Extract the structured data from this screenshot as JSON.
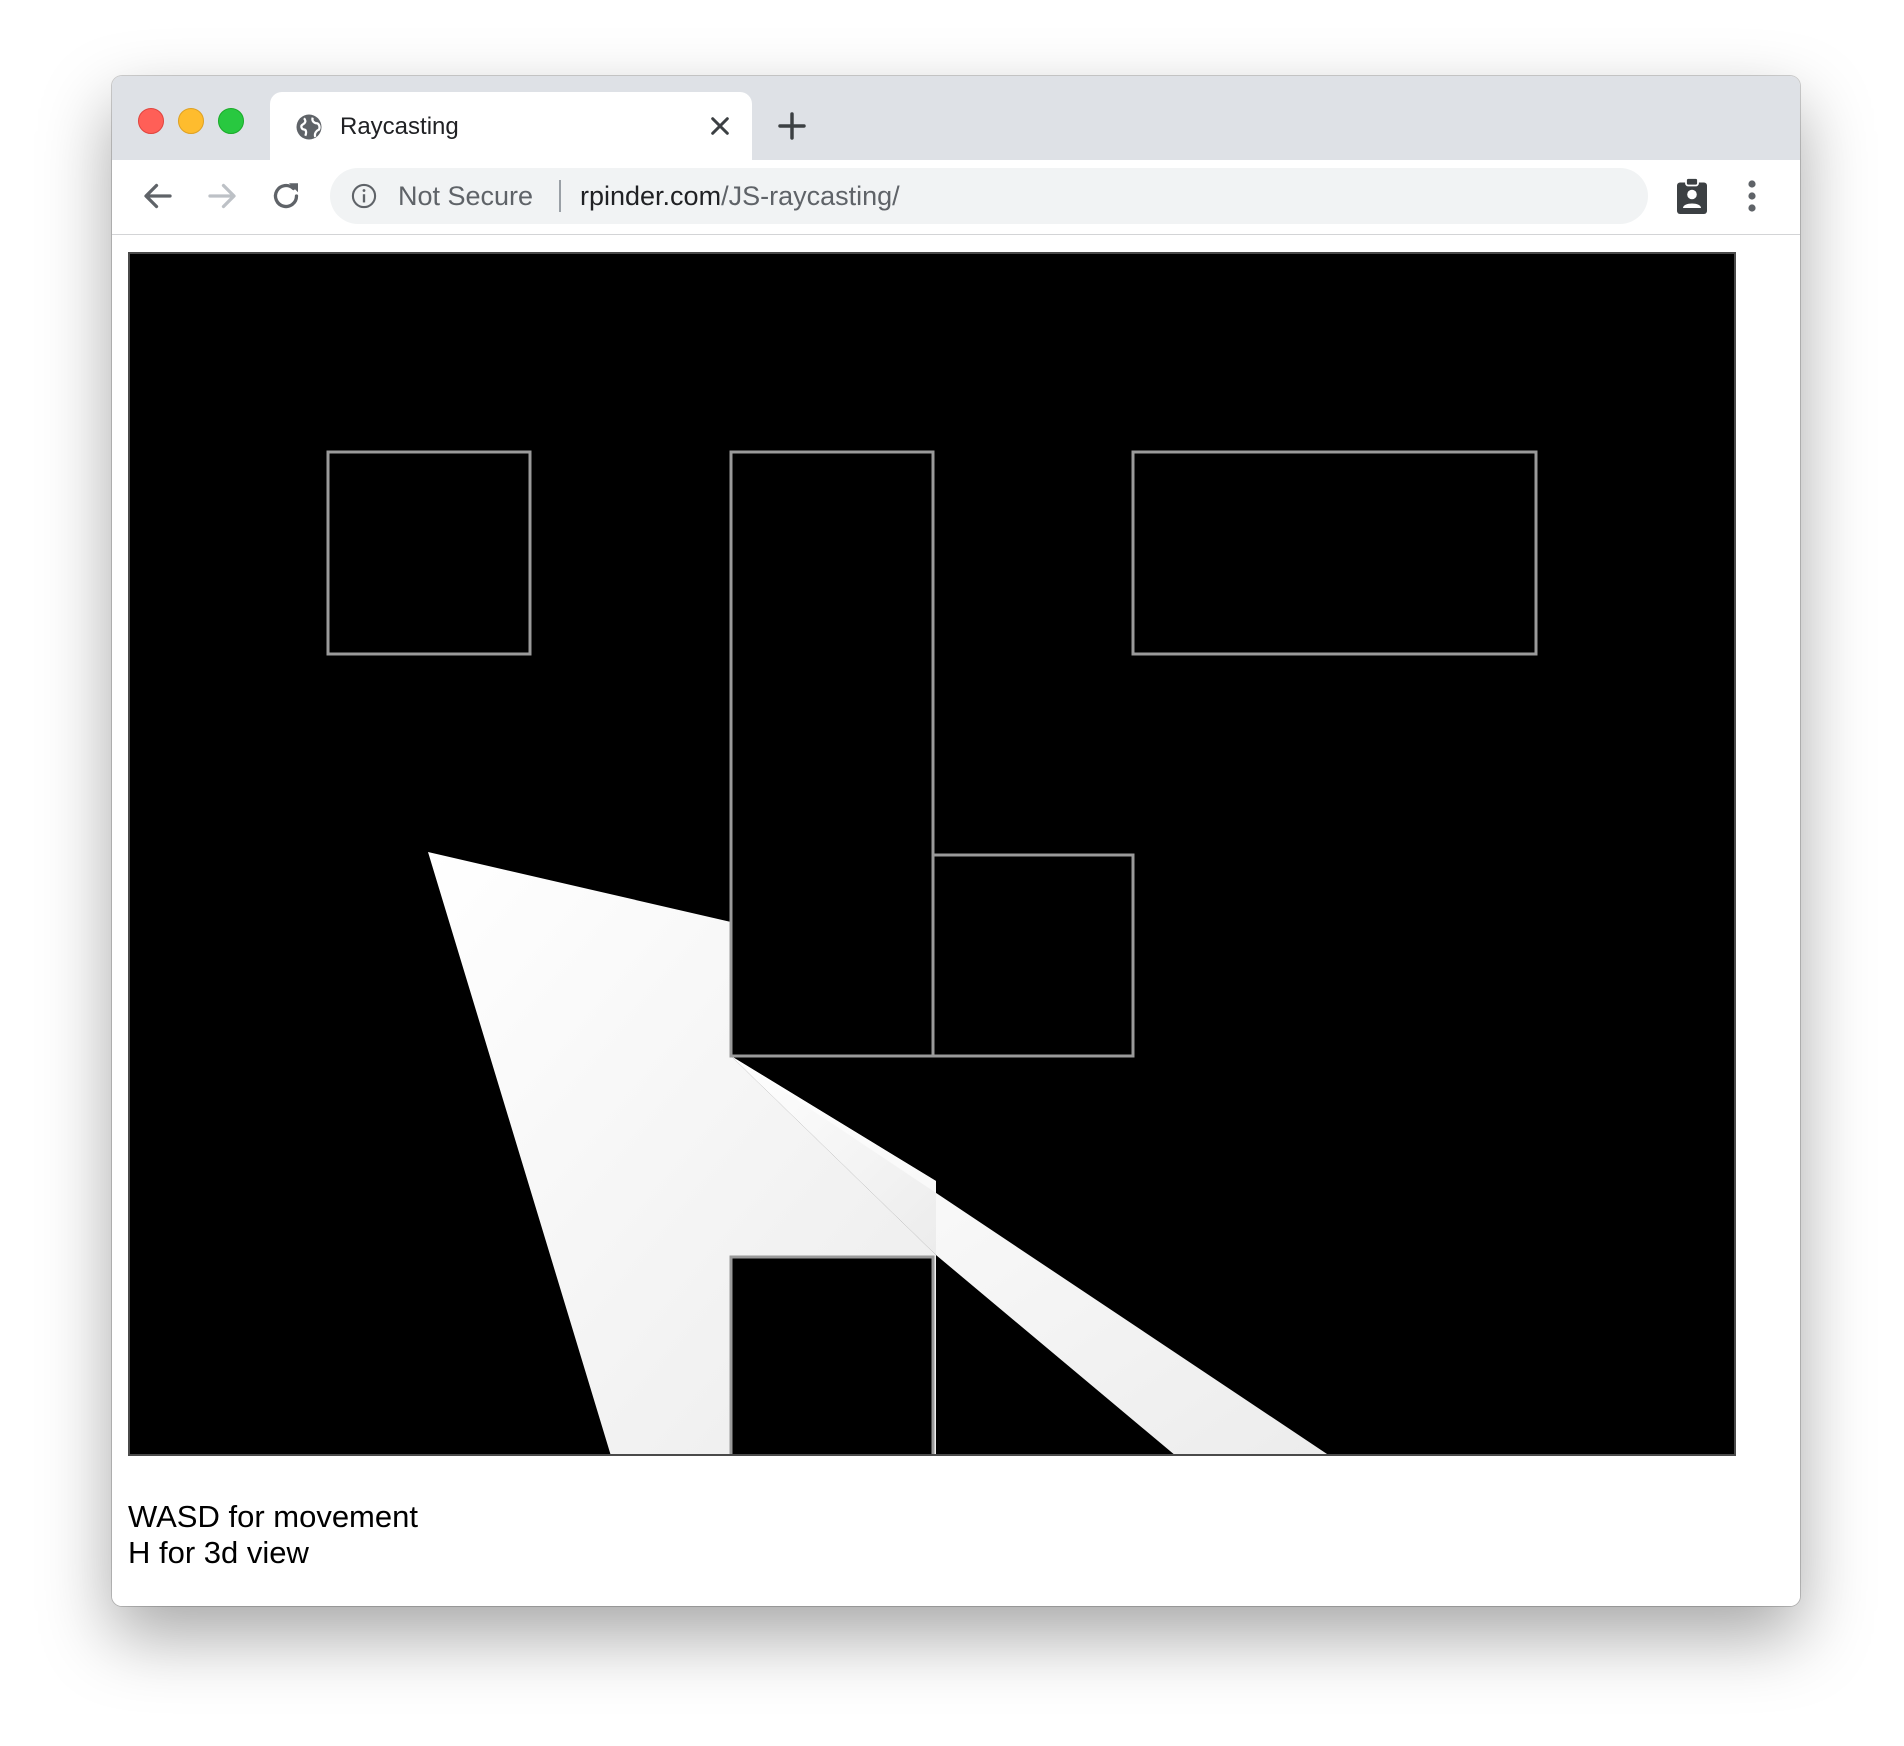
{
  "browser": {
    "tab": {
      "title": "Raycasting",
      "icon": "globe-icon"
    },
    "toolbar": {
      "back_icon": "arrow-left-icon",
      "forward_icon": "arrow-right-icon",
      "reload_icon": "reload-icon",
      "security_icon": "info-icon",
      "security_label": "Not Secure",
      "url_host": "rpinder.com",
      "url_path": "/JS-raycasting/",
      "extension_icon": "clipboard-badge-icon",
      "menu_icon": "more-vert-icon"
    },
    "window_controls": [
      "close",
      "minimize",
      "zoom"
    ]
  },
  "page": {
    "canvas": {
      "background": "#000000",
      "wall_color": "#9a9a9a",
      "light_color": "#f4f4f4"
    },
    "instructions": {
      "line1": "WASD for movement",
      "line2": "H for 3d view"
    }
  },
  "colors": {
    "titlebar": "#dee1e6",
    "omnibox": "#f1f3f4",
    "traffic_red": "#ff5f57",
    "traffic_yellow": "#febc2e",
    "traffic_green": "#28c840"
  }
}
